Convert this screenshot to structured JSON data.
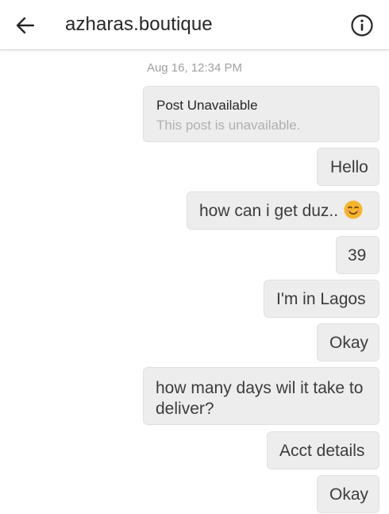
{
  "header": {
    "title": "azharas.boutique",
    "back_icon": "arrow-left-icon",
    "info_icon": "info-circle-icon"
  },
  "thread": {
    "timestamp": "Aug 16, 12:34 PM",
    "post": {
      "title": "Post Unavailable",
      "subtitle": "This post is unavailable."
    },
    "messages": [
      {
        "text": "Hello"
      },
      {
        "text": "how can i get duz..",
        "emoji": "smiling-face-emoji"
      },
      {
        "text": "39"
      },
      {
        "text": "I'm in Lagos"
      },
      {
        "text": "Okay"
      },
      {
        "text": "how many days wil it take to deliver?"
      },
      {
        "text": "Acct details"
      },
      {
        "text": "Okay"
      }
    ]
  },
  "colors": {
    "bubble_bg": "#ededed",
    "text": "#3c3c3c",
    "muted": "#a0a0a0",
    "emoji": "#f5b52e"
  }
}
